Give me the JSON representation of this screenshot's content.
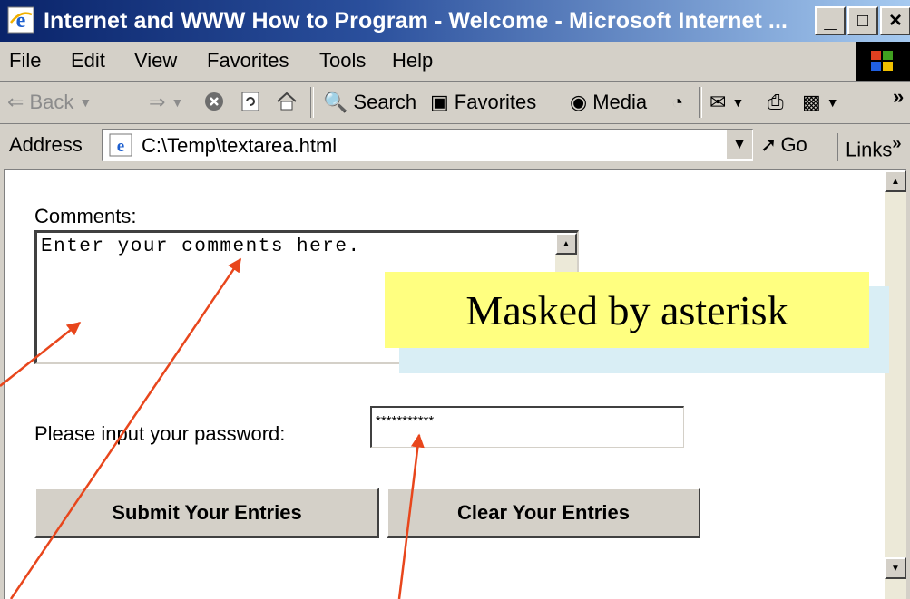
{
  "window": {
    "title": "Internet and WWW How to Program - Welcome - Microsoft Internet ...",
    "controls": [
      "_",
      "□",
      "×"
    ]
  },
  "menu": [
    "File",
    "Edit",
    "View",
    "Favorites",
    "Tools",
    "Help"
  ],
  "toolbar": {
    "back": "Back",
    "search": "Search",
    "favorites": "Favorites",
    "media": "Media",
    "more": "»"
  },
  "address": {
    "label": "Address",
    "value": "C:\\Temp\\textarea.html",
    "go": "Go",
    "links": "Links",
    "links_more": "»"
  },
  "form": {
    "comments_label": "Comments:",
    "textarea_value": "Enter your comments here.",
    "password_label": "Please input your password:",
    "password_value": "***********",
    "submit_label": "Submit Your Entries",
    "clear_label": "Clear Your Entries"
  },
  "annotation": {
    "callout_text": "Masked by asterisk",
    "callout_bg": "#ffff80",
    "arrow_color": "#e8461c"
  }
}
